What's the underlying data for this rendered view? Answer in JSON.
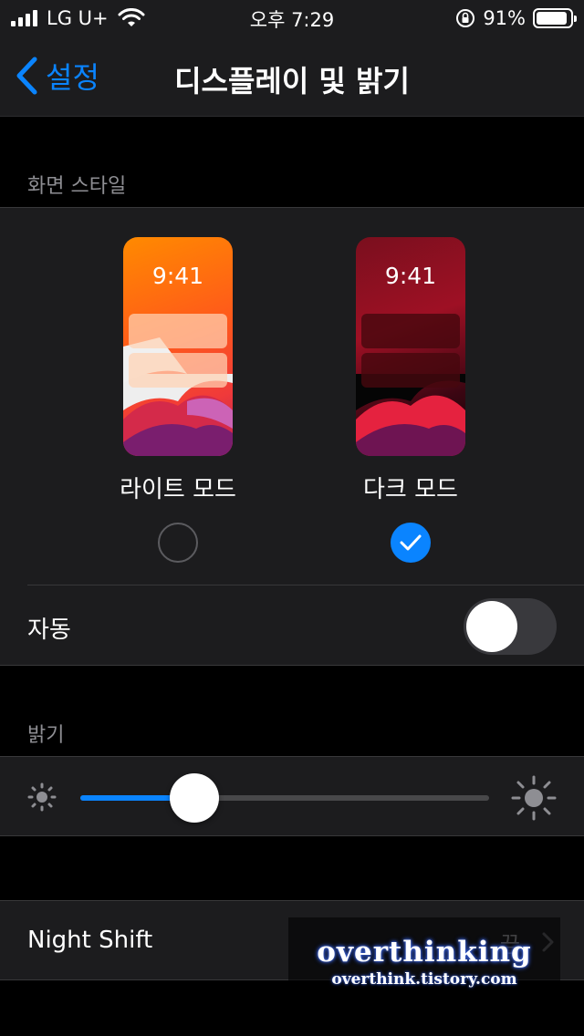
{
  "status_bar": {
    "carrier": "LG U+",
    "time": "오후 7:29",
    "battery": "91%",
    "battery_level": 0.91
  },
  "nav": {
    "back_label": "설정",
    "title": "디스플레이 및 밝기"
  },
  "appearance": {
    "header": "화면 스타일",
    "light_label": "라이트 모드",
    "dark_label": "다크 모드",
    "preview_time": "9:41",
    "selected": "dark"
  },
  "auto": {
    "label": "자동",
    "enabled": false
  },
  "brightness": {
    "header": "밝기",
    "level": 0.28
  },
  "night_shift": {
    "label": "Night Shift",
    "value": "끔"
  },
  "watermark": {
    "title": "overthinking",
    "url": "overthink.tistory.com"
  },
  "colors": {
    "accent": "#0a84ff",
    "background": "#000000",
    "cell": "#1c1c1e",
    "secondary_text": "#8e8e93"
  }
}
